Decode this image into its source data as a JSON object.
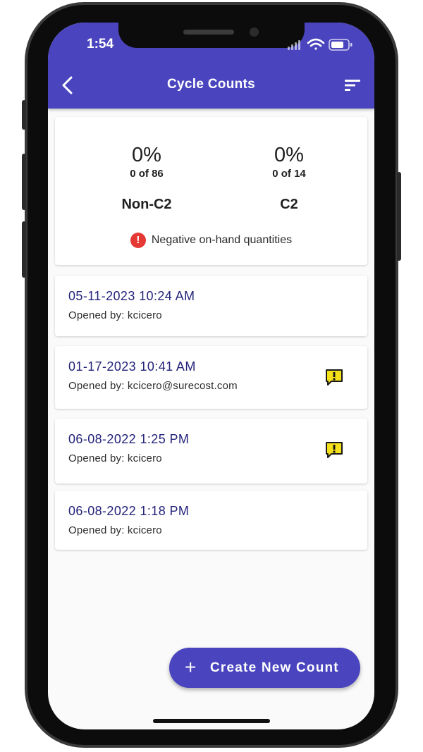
{
  "status_bar": {
    "time": "1:54",
    "icons": [
      "signal-icon",
      "wifi-icon",
      "battery-icon"
    ]
  },
  "app_bar": {
    "title": "Cycle Counts",
    "back_icon": "back-chevron-icon",
    "sort_icon": "sort-icon"
  },
  "summary": {
    "non_c2": {
      "percent": "0%",
      "fraction": "0 of 86",
      "label": "Non-C2"
    },
    "c2": {
      "percent": "0%",
      "fraction": "0 of 14",
      "label": "C2"
    },
    "warning": {
      "icon": "error-icon",
      "glyph": "!",
      "text": "Negative on-hand quantities"
    }
  },
  "counts": [
    {
      "date": "05-11-2023 10:24 AM",
      "opened_by": "Opened by: kcicero",
      "flag": false
    },
    {
      "date": "01-17-2023 10:41 AM",
      "opened_by": "Opened by: kcicero@surecost.com",
      "flag": true
    },
    {
      "date": "06-08-2022 1:25 PM",
      "opened_by": "Opened by: kcicero",
      "flag": true
    },
    {
      "date": "06-08-2022 1:18 PM",
      "opened_by": "Opened by: kcicero",
      "flag": false
    }
  ],
  "fab": {
    "plus": "+",
    "label": "Create New Count"
  },
  "colors": {
    "primary": "#4a45be",
    "date_text": "#23237a",
    "error": "#e53935",
    "warning_flag": "#f5e11a"
  }
}
